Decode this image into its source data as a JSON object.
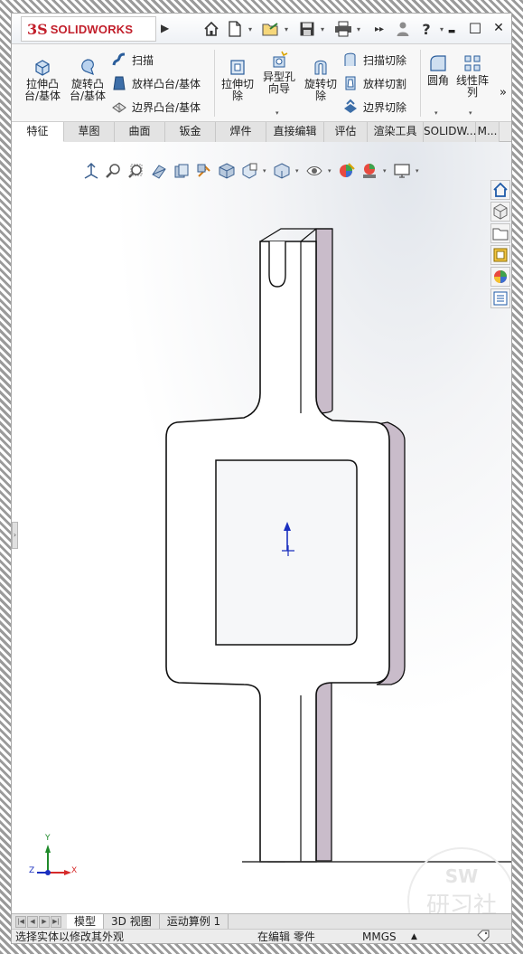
{
  "app": {
    "logo_ds": "3S",
    "logo_text": "SOLIDWORKS"
  },
  "quick_access": {
    "icons": [
      "home-icon",
      "new-document-icon",
      "open-folder-icon",
      "save-icon",
      "print-icon",
      "undo-icon",
      "user-icon",
      "help-icon"
    ]
  },
  "window_controls": {
    "minimize": "▬",
    "restore": "☐",
    "close": "✕"
  },
  "ribbon": {
    "extrude_boss": "拉伸凸\n台/基体",
    "revolve_boss": "旋转凸\n台/基体",
    "sweep": "扫描",
    "loft_boss": "放样凸台/基体",
    "boundary_boss": "边界凸台/基体",
    "extrude_cut": "拉伸切\n除",
    "hole_wizard": "异型孔\n向导",
    "revolve_cut": "旋转切\n除",
    "swept_cut": "扫描切除",
    "lofted_cut": "放样切割",
    "boundary_cut": "边界切除",
    "fillet": "圆角",
    "linear_pattern": "线性阵\n列",
    "more": "»"
  },
  "tabs": [
    {
      "label": "特征",
      "active": true
    },
    {
      "label": "草图",
      "active": false
    },
    {
      "label": "曲面",
      "active": false
    },
    {
      "label": "钣金",
      "active": false
    },
    {
      "label": "焊件",
      "active": false
    },
    {
      "label": "直接编辑",
      "active": false
    },
    {
      "label": "评估",
      "active": false
    },
    {
      "label": "渲染工具",
      "active": false
    },
    {
      "label": "SOLIDW...",
      "active": false
    },
    {
      "label": "M...",
      "active": false
    }
  ],
  "triad": {
    "x": "X",
    "y": "Y",
    "z": "Z"
  },
  "watermark": {
    "line1": "SW",
    "line2": "研习社"
  },
  "bottom_tabs": [
    {
      "label": "模型",
      "active": true
    },
    {
      "label": "3D 视图",
      "active": false
    },
    {
      "label": "运动算例 1",
      "active": false
    }
  ],
  "status": {
    "message": "选择实体以修改其外观",
    "mode": "在编辑 零件",
    "units": "MMGS",
    "units_arrow": "▲"
  },
  "colors": {
    "brand": "#c21f2b",
    "model_side": "#c9bcca",
    "axis_x": "#d62a2a",
    "axis_y": "#1f8a2a",
    "axis_z": "#1a2fbf"
  }
}
